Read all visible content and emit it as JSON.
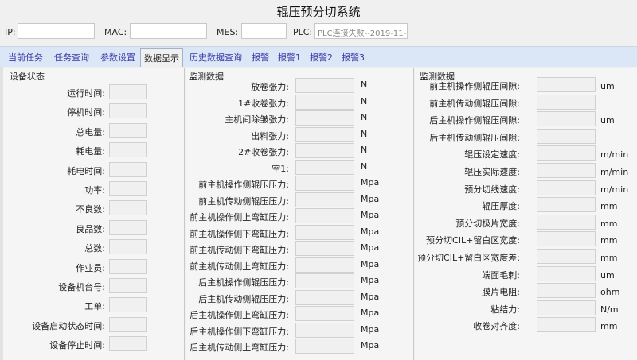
{
  "app": {
    "title": "辊压预分切系统"
  },
  "connection": {
    "ip_label": "IP:",
    "ip_value": "",
    "mac_label": "MAC:",
    "mac_value": "",
    "mes_label": "MES:",
    "mes_value": "",
    "plc_label": "PLC:",
    "plc_value": "PLC连接失败--2019-11-"
  },
  "tabs": [
    {
      "label": "当前任务"
    },
    {
      "label": "任务查询"
    },
    {
      "label": "参数设置"
    },
    {
      "label": "数据显示",
      "active": true
    },
    {
      "label": "历史数据查询"
    },
    {
      "label": "报警"
    },
    {
      "label": "报警1"
    },
    {
      "label": "报警2"
    },
    {
      "label": "报警3"
    }
  ],
  "device_status": {
    "title": "设备状态",
    "rows": [
      {
        "label": "运行时间:"
      },
      {
        "label": "停机时间:"
      },
      {
        "label": "总电量:"
      },
      {
        "label": "耗电量:"
      },
      {
        "label": "耗电时间:"
      },
      {
        "label": "功率:"
      },
      {
        "label": "不良数:"
      },
      {
        "label": "良品数:"
      },
      {
        "label": "总数:"
      },
      {
        "label": "作业员:"
      },
      {
        "label": "设备机台号:"
      },
      {
        "label": "工单:"
      },
      {
        "label": "设备启动状态时间:"
      },
      {
        "label": "设备停止时间:"
      }
    ]
  },
  "monitor_mid": {
    "title": "监测数据",
    "rows": [
      {
        "label": "放卷张力:",
        "unit": "N"
      },
      {
        "label": "1#收卷张力:",
        "unit": "N"
      },
      {
        "label": "主机间除皱张力:",
        "unit": "N"
      },
      {
        "label": "出料张力:",
        "unit": "N"
      },
      {
        "label": "2#收卷张力:",
        "unit": "N"
      },
      {
        "label": "空1:",
        "unit": "N"
      },
      {
        "label": "前主机操作侧辊压压力:",
        "unit": "Mpa"
      },
      {
        "label": "前主机传动侧辊压压力:",
        "unit": "Mpa"
      },
      {
        "label": "前主机操作侧上弯缸压力:",
        "unit": "Mpa"
      },
      {
        "label": "前主机操作侧下弯缸压力:",
        "unit": "Mpa"
      },
      {
        "label": "前主机传动侧下弯缸压力:",
        "unit": "Mpa"
      },
      {
        "label": "前主机传动侧上弯缸压力:",
        "unit": "Mpa"
      },
      {
        "label": "后主机操作侧辊压压力:",
        "unit": "Mpa"
      },
      {
        "label": "后主机传动侧辊压压力:",
        "unit": "Mpa"
      },
      {
        "label": "后主机操作侧上弯缸压力:",
        "unit": "Mpa"
      },
      {
        "label": "后主机操作侧下弯缸压力:",
        "unit": "Mpa"
      },
      {
        "label": "后主机传动侧上弯缸压力:",
        "unit": "Mpa"
      }
    ]
  },
  "monitor_right": {
    "title": "监测数据",
    "rows": [
      {
        "label": "前主机操作侧辊压间隙:",
        "unit": "um"
      },
      {
        "label": "前主机传动侧辊压间隙:",
        "unit": ""
      },
      {
        "label": "后主机操作侧辊压间隙:",
        "unit": "um"
      },
      {
        "label": "后主机传动侧辊压间隙:",
        "unit": ""
      },
      {
        "label": "辊压设定速度:",
        "unit": "m/min"
      },
      {
        "label": "辊压实际速度:",
        "unit": "m/min"
      },
      {
        "label": "预分切线速度:",
        "unit": "m/min"
      },
      {
        "label": "辊压厚度:",
        "unit": "mm"
      },
      {
        "label": "预分切极片宽度:",
        "unit": "mm"
      },
      {
        "label": "预分切CIL+留白区宽度:",
        "unit": "mm"
      },
      {
        "label": "预分切CIL+留白区宽度差:",
        "unit": "mm"
      },
      {
        "label": "端面毛刺:",
        "unit": "um"
      },
      {
        "label": "膜片电阻:",
        "unit": "ohm"
      },
      {
        "label": "粘结力:",
        "unit": "N/m"
      },
      {
        "label": "收卷对齐度:",
        "unit": "mm"
      }
    ]
  }
}
